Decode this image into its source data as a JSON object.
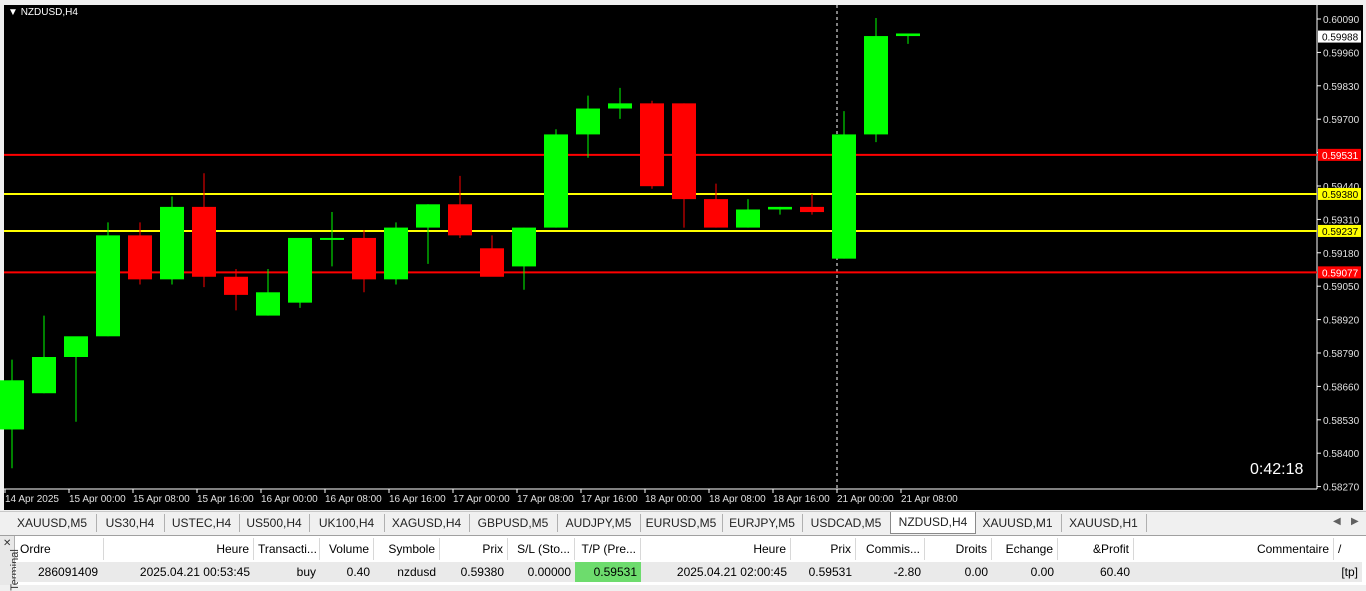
{
  "chart": {
    "symbol_title": "NZDUSD,H4",
    "countdown": "0:42:18",
    "price_labels": [
      "0.60090",
      "0.59960",
      "0.59830",
      "0.59700",
      "0.59570",
      "0.59440",
      "0.59310",
      "0.59180",
      "0.59050",
      "0.58920",
      "0.58790",
      "0.58660",
      "0.58530",
      "0.58400",
      "0.58270"
    ],
    "time_labels": [
      "14 Apr 2025",
      "15 Apr 00:00",
      "15 Apr 08:00",
      "15 Apr 16:00",
      "16 Apr 00:00",
      "16 Apr 08:00",
      "16 Apr 16:00",
      "17 Apr 00:00",
      "17 Apr 08:00",
      "17 Apr 16:00",
      "18 Apr 00:00",
      "18 Apr 08:00",
      "18 Apr 16:00",
      "21 Apr 00:00",
      "21 Apr 08:00"
    ],
    "current_price": "0.59988",
    "levels": [
      {
        "price": 0.59531,
        "label": "0.59531",
        "color": "#ff0000"
      },
      {
        "price": 0.5938,
        "label": "0.59380",
        "color": "#ffff00"
      },
      {
        "price": 0.59237,
        "label": "0.59237",
        "color": "#ffff00"
      },
      {
        "price": 0.59077,
        "label": "0.59077",
        "color": "#ff0000"
      }
    ],
    "colors": {
      "background": "#000000",
      "bull": "#00ff00",
      "bear": "#ff0000",
      "axis": "#ffffff",
      "current_tag_bg": "#ffffff"
    }
  },
  "chart_data": {
    "type": "candlestick",
    "bull_color": "#00ff00",
    "bear_color": "#ff0000",
    "candles": [
      {
        "o": 0.5847,
        "h": 0.5874,
        "l": 0.5832,
        "c": 0.5866
      },
      {
        "o": 0.5861,
        "h": 0.5891,
        "l": 0.5861,
        "c": 0.5875
      },
      {
        "o": 0.5875,
        "h": 0.5875,
        "l": 0.585,
        "c": 0.5883
      },
      {
        "o": 0.5883,
        "h": 0.5927,
        "l": 0.5883,
        "c": 0.5922
      },
      {
        "o": 0.5922,
        "h": 0.5927,
        "l": 0.5903,
        "c": 0.5905
      },
      {
        "o": 0.5905,
        "h": 0.5937,
        "l": 0.5903,
        "c": 0.5933
      },
      {
        "o": 0.5933,
        "h": 0.5946,
        "l": 0.5902,
        "c": 0.5906
      },
      {
        "o": 0.5906,
        "h": 0.5909,
        "l": 0.5893,
        "c": 0.5899
      },
      {
        "o": 0.5891,
        "h": 0.5909,
        "l": 0.5891,
        "c": 0.59
      },
      {
        "o": 0.5896,
        "h": 0.5921,
        "l": 0.5894,
        "c": 0.5921
      },
      {
        "o": 0.5921,
        "h": 0.5931,
        "l": 0.591,
        "c": 0.5921
      },
      {
        "o": 0.5921,
        "h": 0.5924,
        "l": 0.59,
        "c": 0.5905
      },
      {
        "o": 0.5905,
        "h": 0.5927,
        "l": 0.5903,
        "c": 0.5925
      },
      {
        "o": 0.5925,
        "h": 0.5934,
        "l": 0.5911,
        "c": 0.5934
      },
      {
        "o": 0.5934,
        "h": 0.5945,
        "l": 0.5921,
        "c": 0.5922
      },
      {
        "o": 0.5917,
        "h": 0.5922,
        "l": 0.5909,
        "c": 0.5906
      },
      {
        "o": 0.591,
        "h": 0.5925,
        "l": 0.5901,
        "c": 0.5925
      },
      {
        "o": 0.5925,
        "h": 0.5963,
        "l": 0.5925,
        "c": 0.5961
      },
      {
        "o": 0.5961,
        "h": 0.5976,
        "l": 0.5952,
        "c": 0.5971
      },
      {
        "o": 0.5971,
        "h": 0.5979,
        "l": 0.5967,
        "c": 0.5973
      },
      {
        "o": 0.5973,
        "h": 0.5974,
        "l": 0.594,
        "c": 0.5941
      },
      {
        "o": 0.5973,
        "h": 0.5973,
        "l": 0.5925,
        "c": 0.5936
      },
      {
        "o": 0.5936,
        "h": 0.5942,
        "l": 0.5925,
        "c": 0.5925
      },
      {
        "o": 0.5925,
        "h": 0.5936,
        "l": 0.5925,
        "c": 0.5932
      },
      {
        "o": 0.5932,
        "h": 0.5933,
        "l": 0.593,
        "c": 0.5933
      },
      {
        "o": 0.5933,
        "h": 0.5938,
        "l": 0.593,
        "c": 0.5931
      },
      {
        "o": 0.5913,
        "h": 0.597,
        "l": 0.5913,
        "c": 0.5961
      },
      {
        "o": 0.5961,
        "h": 0.6006,
        "l": 0.5958,
        "c": 0.5999
      },
      {
        "o": 0.5999,
        "h": 0.6,
        "l": 0.5996,
        "c": 0.6
      }
    ],
    "ylim": [
      0.5824,
      0.6011
    ],
    "grid": false
  },
  "tabs": [
    {
      "label": "XAUUSD,M5",
      "active": false
    },
    {
      "label": "US30,H4",
      "active": false
    },
    {
      "label": "USTEC,H4",
      "active": false
    },
    {
      "label": "US500,H4",
      "active": false
    },
    {
      "label": "UK100,H4",
      "active": false
    },
    {
      "label": "XAGUSD,H4",
      "active": false
    },
    {
      "label": "GBPUSD,M5",
      "active": false
    },
    {
      "label": "AUDJPY,M5",
      "active": false
    },
    {
      "label": "EURUSD,M5",
      "active": false
    },
    {
      "label": "EURJPY,M5",
      "active": false
    },
    {
      "label": "USDCAD,M5",
      "active": false
    },
    {
      "label": "NZDUSD,H4",
      "active": true
    },
    {
      "label": "XAUUSD,M1",
      "active": false
    },
    {
      "label": "XAUUSD,H1",
      "active": false
    }
  ],
  "terminal": {
    "side_label": "Terminal",
    "close_glyph": "✕",
    "headers": [
      "Ordre",
      "Heure",
      "Transacti...",
      "Volume",
      "Symbole",
      "Prix",
      "S/L (Sto...",
      "T/P (Pre...",
      "Heure",
      "Prix",
      "Commis...",
      "Droits",
      "Echange",
      "&Profit",
      "Commentaire"
    ],
    "sort_indicator": "/",
    "row": [
      "286091409",
      "2025.04.21 00:53:45",
      "buy",
      "0.40",
      "nzdusd",
      "0.59380",
      "0.00000",
      "0.59531",
      "2025.04.21 02:00:45",
      "0.59531",
      "-2.80",
      "0.00",
      "0.00",
      "60.40",
      "[tp]"
    ]
  }
}
